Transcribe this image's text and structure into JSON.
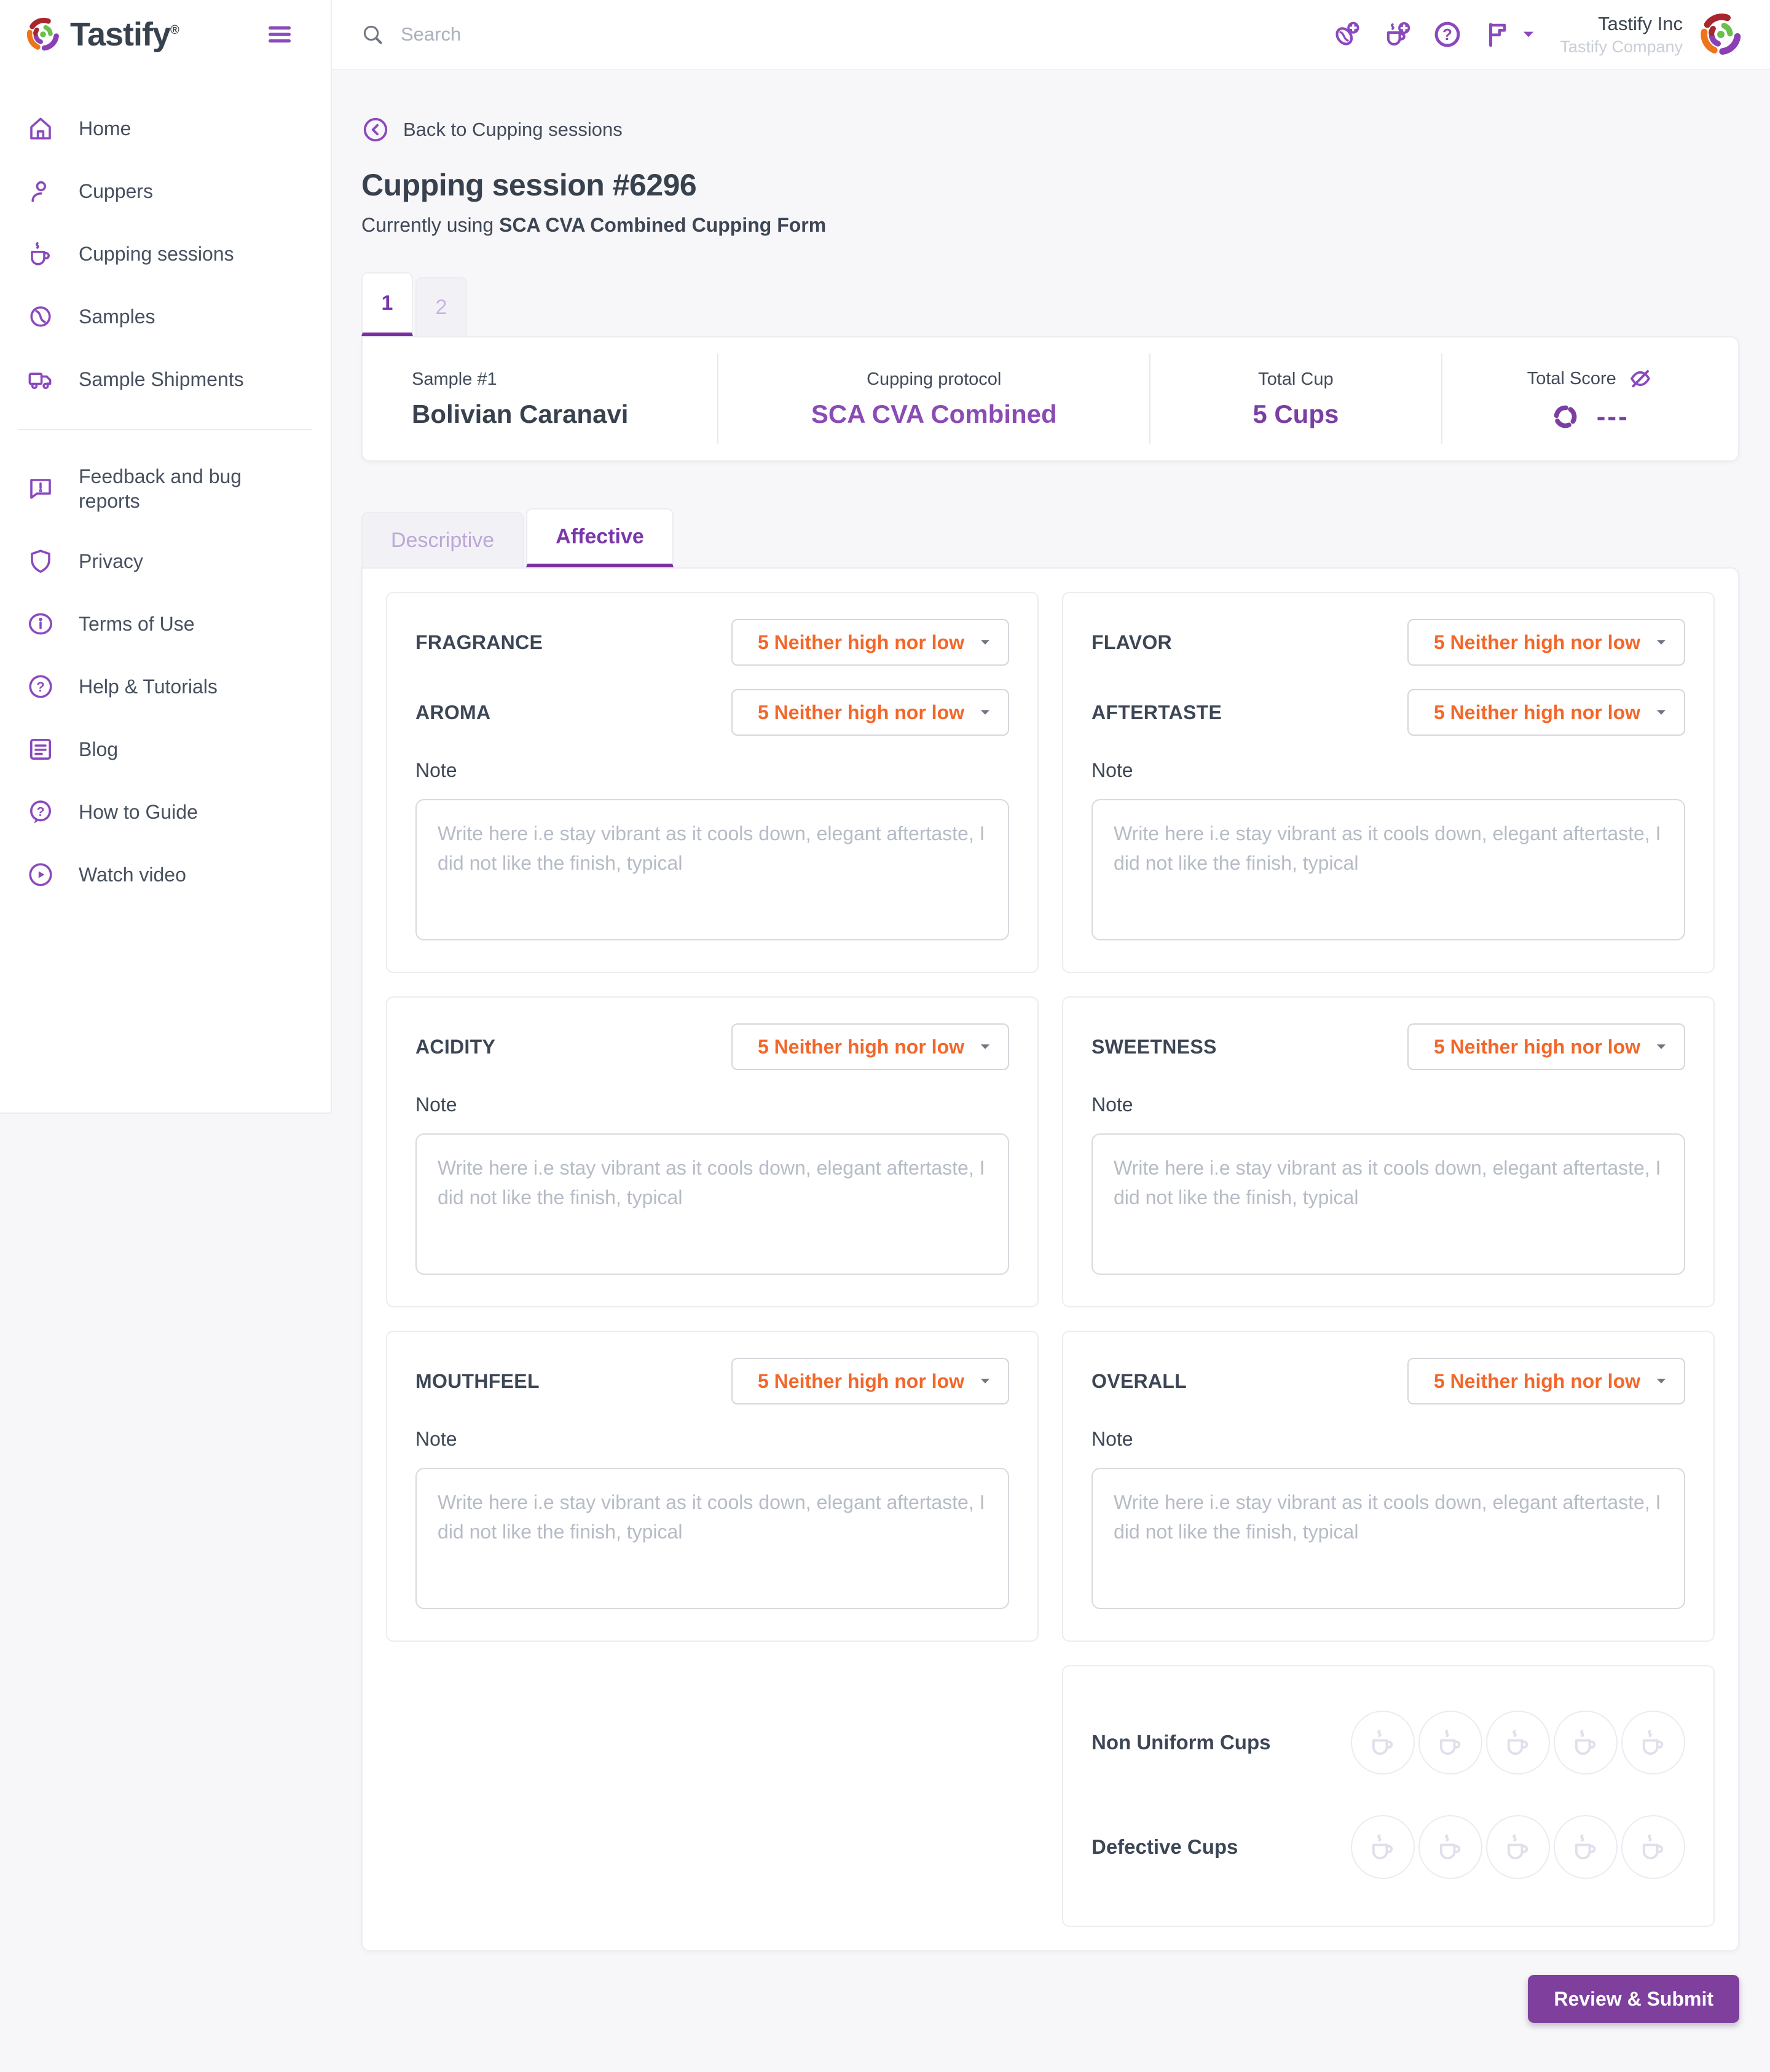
{
  "brand": {
    "name": "Tastify",
    "trademark": "®"
  },
  "topbar": {
    "search_placeholder": "Search",
    "actions": [
      {
        "name": "add-sample",
        "icon": "bean-plus"
      },
      {
        "name": "add-cupping-session",
        "icon": "cup-plus"
      },
      {
        "name": "help",
        "icon": "help-circle"
      },
      {
        "name": "language-flag",
        "icon": "flag",
        "caret": true
      }
    ],
    "company_name": "Tastify Inc",
    "company_sub": "Tastify Company",
    "avatar_icon": "brandmark"
  },
  "sidebar": {
    "primary": [
      {
        "label": "Home",
        "icon": "home"
      },
      {
        "label": "Cuppers",
        "icon": "user"
      },
      {
        "label": "Cupping sessions",
        "icon": "cup"
      },
      {
        "label": "Samples",
        "icon": "bean"
      },
      {
        "label": "Sample Shipments",
        "icon": "truck"
      }
    ],
    "secondary": [
      {
        "label": "Feedback and bug reports",
        "icon": "feedback"
      },
      {
        "label": "Privacy",
        "icon": "shield"
      },
      {
        "label": "Terms of Use",
        "icon": "info-circle"
      },
      {
        "label": "Help & Tutorials",
        "icon": "question-circle"
      },
      {
        "label": "Blog",
        "icon": "blog"
      },
      {
        "label": "How to Guide",
        "icon": "question-bubble"
      },
      {
        "label": "Watch video",
        "icon": "play-circle"
      }
    ]
  },
  "header": {
    "back_label": "Back to Cupping sessions",
    "title": "Cupping session #6296",
    "subtitle_prefix": "Currently using ",
    "subtitle_bold": "SCA CVA Combined Cupping Form"
  },
  "sample_tabs": [
    "1",
    "2"
  ],
  "summary": {
    "sample": {
      "label": "Sample #1",
      "value": "Bolivian Caranavi"
    },
    "protocol": {
      "label": "Cupping protocol",
      "value": "SCA CVA Combined"
    },
    "total_cup": {
      "label": "Total Cup",
      "value": "5 Cups"
    },
    "total_score": {
      "label": "Total Score",
      "value": "---",
      "hidden_icon": "eye-off",
      "loading_icon": "sync"
    }
  },
  "form_tabs": [
    {
      "label": "Descriptive",
      "active": false
    },
    {
      "label": "Affective",
      "active": true
    }
  ],
  "select": {
    "value": "5 Neither high nor low"
  },
  "note": {
    "label": "Note",
    "placeholder": "Write here i.e stay vibrant as it cools down, elegant aftertaste, I did not like the finish, typical"
  },
  "panels": [
    {
      "attributes": [
        {
          "name": "fragrance",
          "label": "FRAGRANCE"
        },
        {
          "name": "aroma",
          "label": "AROMA"
        }
      ]
    },
    {
      "attributes": [
        {
          "name": "flavor",
          "label": "FLAVOR"
        },
        {
          "name": "aftertaste",
          "label": "AFTERTASTE"
        }
      ]
    },
    {
      "attributes": [
        {
          "name": "acidity",
          "label": "ACIDITY"
        }
      ]
    },
    {
      "attributes": [
        {
          "name": "sweetness",
          "label": "SWEETNESS"
        }
      ]
    },
    {
      "attributes": [
        {
          "name": "mouthfeel",
          "label": "MOUTHFEEL"
        }
      ]
    },
    {
      "attributes": [
        {
          "name": "overall",
          "label": "OVERALL"
        }
      ]
    }
  ],
  "cups_panel": {
    "rows": [
      {
        "name": "non-uniform-cups",
        "label": "Non Uniform Cups",
        "count": 5
      },
      {
        "name": "defective-cups",
        "label": "Defective Cups",
        "count": 5
      }
    ],
    "cup_icon": "cup"
  },
  "submit_label": "Review & Submit",
  "colors": {
    "accent_purple": "#7e3f9d",
    "accent_purple_icon": "#8b49bd",
    "accent_orange": "#f2672a",
    "text_dark": "#38424e",
    "muted_gray": "#b6bcc6",
    "page_bg": "#f7f7f9",
    "border_light": "#ececf1"
  }
}
